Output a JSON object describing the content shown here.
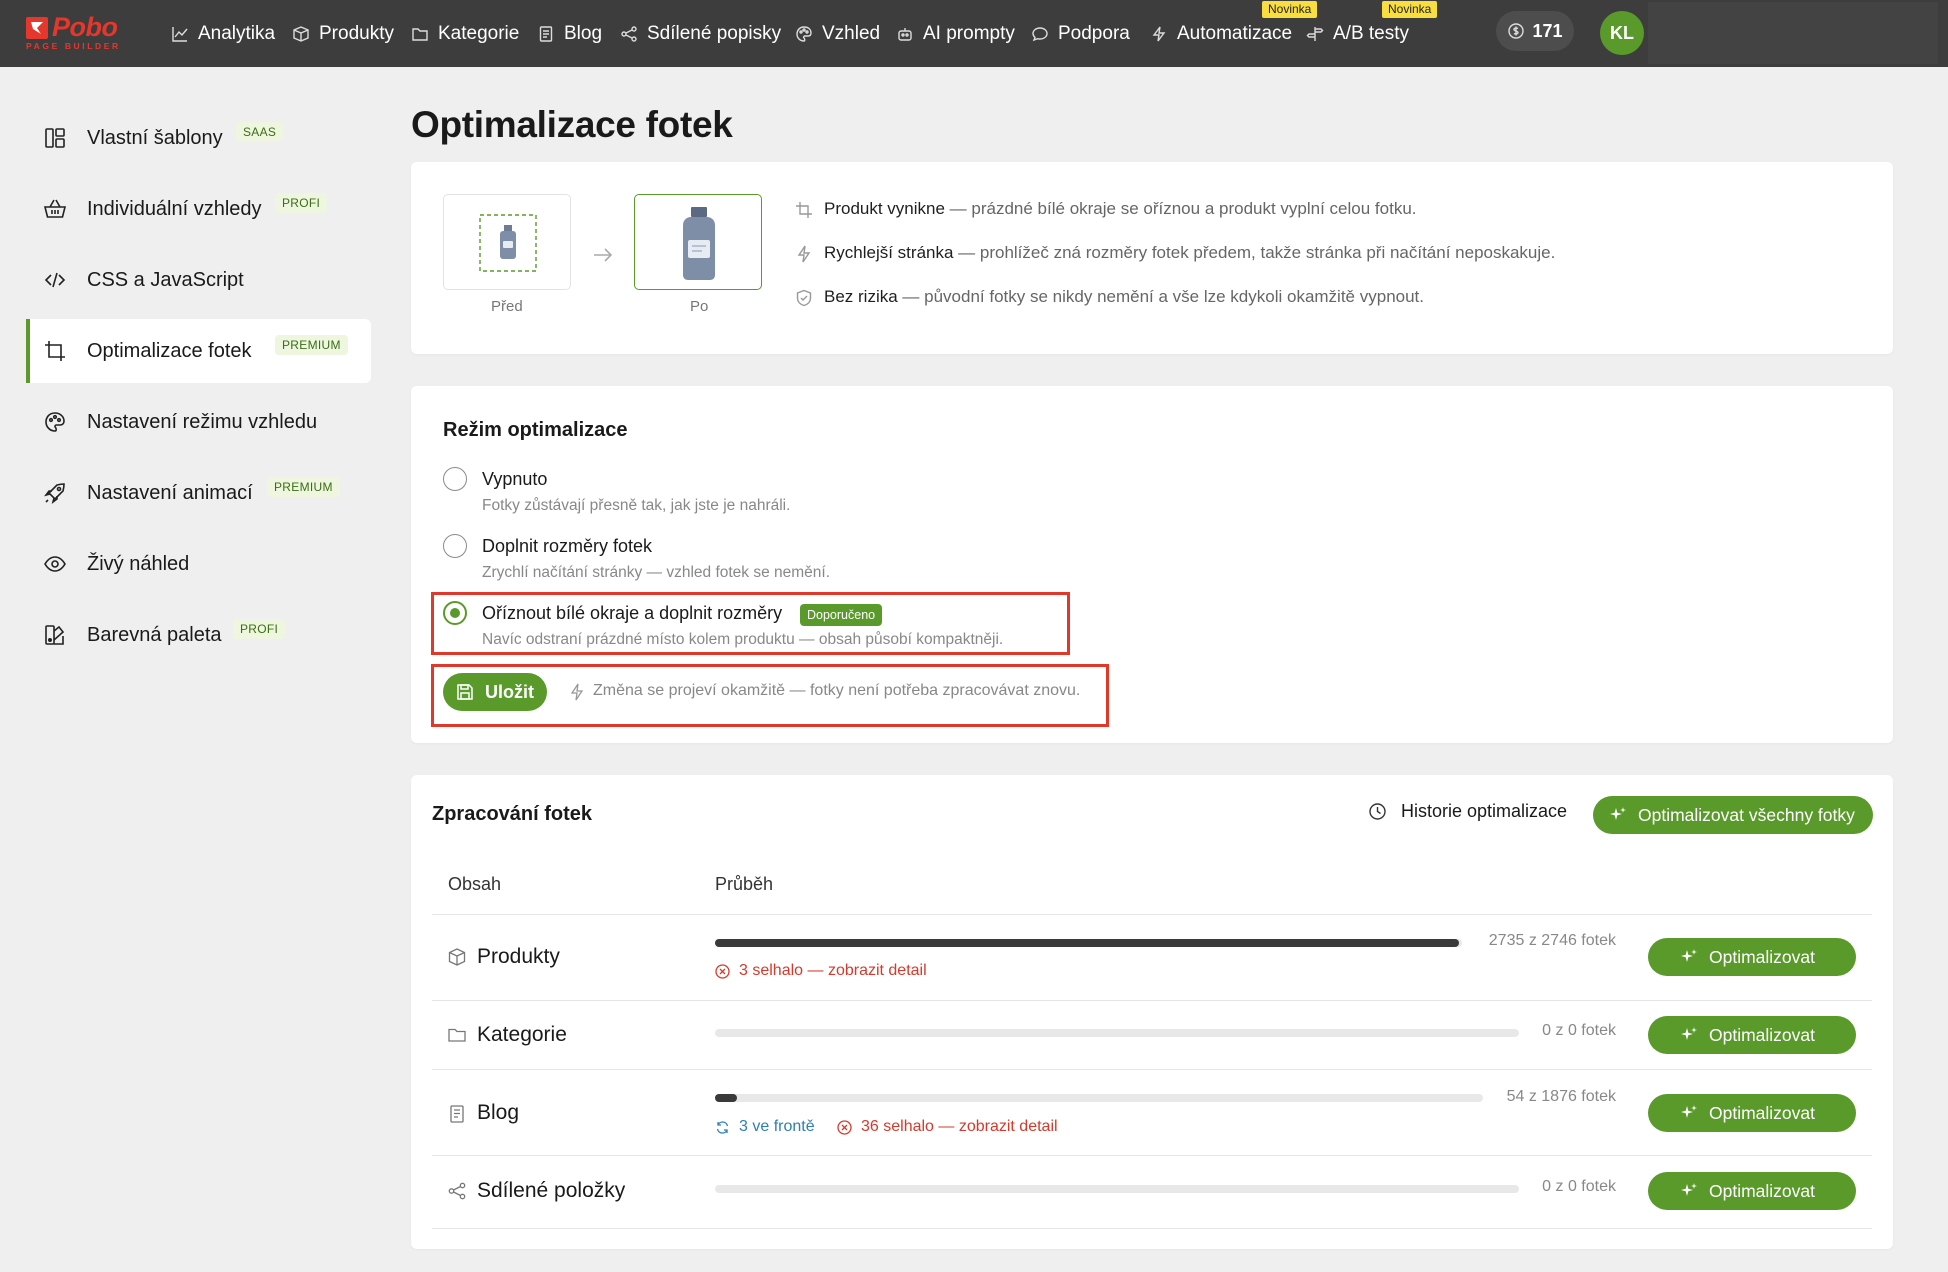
{
  "topbar": {
    "logo_text": "Pobo",
    "logo_sub": "PAGE BUILDER",
    "nav": [
      {
        "label": "Analytika",
        "icon": "chart-line-icon"
      },
      {
        "label": "Produkty",
        "icon": "box-icon"
      },
      {
        "label": "Kategorie",
        "icon": "folder-icon"
      },
      {
        "label": "Blog",
        "icon": "document-icon"
      },
      {
        "label": "Sdílené popisky",
        "icon": "share-icon"
      },
      {
        "label": "Vzhled",
        "icon": "palette-icon"
      },
      {
        "label": "AI prompty",
        "icon": "robot-icon"
      },
      {
        "label": "Podpora",
        "icon": "chat-icon"
      },
      {
        "label": "Automatizace",
        "icon": "lightning-icon",
        "badge": "Novinka"
      },
      {
        "label": "A/B testy",
        "icon": "signpost-icon",
        "badge": "Novinka"
      }
    ],
    "credits": "171",
    "avatar_initials": "KL"
  },
  "sidebar": {
    "items": [
      {
        "label": "Vlastní šablony",
        "badge": "SAAS",
        "icon": "layout-icon"
      },
      {
        "label": "Individuální vzhledy",
        "badge": "PROFI",
        "icon": "basket-icon"
      },
      {
        "label": "CSS a JavaScript",
        "badge": "",
        "icon": "code-icon"
      },
      {
        "label": "Optimalizace fotek",
        "badge": "PREMIUM",
        "icon": "crop-icon",
        "active": true
      },
      {
        "label": "Nastavení režimu vzhledu",
        "badge": "",
        "icon": "palette-icon"
      },
      {
        "label": "Nastavení animací",
        "badge": "PREMIUM",
        "icon": "rocket-icon"
      },
      {
        "label": "Živý náhled",
        "badge": "",
        "icon": "eye-icon"
      },
      {
        "label": "Barevná paleta",
        "badge": "PROFI",
        "icon": "swatch-icon"
      }
    ]
  },
  "page": {
    "title": "Optimalizace fotek"
  },
  "intro": {
    "before_label": "Před",
    "after_label": "Po",
    "benefits": [
      {
        "title": "Produkt vynikne",
        "text": " — prázdné bílé okraje se oříznou a produkt vyplní celou fotku.",
        "icon": "crop-icon"
      },
      {
        "title": "Rychlejší stránka",
        "text": " — prohlížeč zná rozměry fotek předem, takže stránka při načítání neposkakuje.",
        "icon": "lightning-icon"
      },
      {
        "title": "Bez rizika",
        "text": " — původní fotky se nikdy nemění a vše lze kdykoli okamžitě vypnout.",
        "icon": "shield-check-icon"
      }
    ]
  },
  "mode": {
    "title": "Režim optimalizace",
    "options": [
      {
        "label": "Vypnuto",
        "desc": "Fotky zůstávají přesně tak, jak jste je nahráli.",
        "checked": false
      },
      {
        "label": "Doplnit rozměry fotek",
        "desc": "Zrychlí načítání stránky — vzhled fotek se nemění.",
        "checked": false
      },
      {
        "label": "Oříznout bílé okraje a doplnit rozměry",
        "desc": "Navíc odstraní prázdné místo kolem produktu — obsah působí kompaktněji.",
        "checked": true,
        "badge": "Doporučeno"
      }
    ],
    "save_label": "Uložit",
    "save_hint": "Změna se projeví okamžitě — fotky není potřeba zpracovávat znovu."
  },
  "processing": {
    "title": "Zpracování fotek",
    "history_label": "Historie optimalizace",
    "optimize_all_label": "Optimalizovat všechny fotky",
    "col_content": "Obsah",
    "col_progress": "Průběh",
    "rows": [
      {
        "name": "Produkty",
        "icon": "box-icon",
        "done": 2735,
        "total": 2746,
        "count_text": "2735 z 2746 fotek",
        "fail_text": "3 selhalo — zobrazit detail",
        "queue_text": "",
        "button": "Optimalizovat"
      },
      {
        "name": "Kategorie",
        "icon": "folder-icon",
        "done": 0,
        "total": 0,
        "count_text": "0 z 0 fotek",
        "fail_text": "",
        "queue_text": "",
        "button": "Optimalizovat"
      },
      {
        "name": "Blog",
        "icon": "document-icon",
        "done": 54,
        "total": 1876,
        "count_text": "54 z 1876 fotek",
        "fail_text": "36 selhalo — zobrazit detail",
        "queue_text": "3 ve frontě",
        "button": "Optimalizovat"
      },
      {
        "name": "Sdílené položky",
        "icon": "share-icon",
        "done": 0,
        "total": 0,
        "count_text": "0 z 0 fotek",
        "fail_text": "",
        "queue_text": "",
        "button": "Optimalizovat"
      }
    ]
  },
  "colors": {
    "accent": "#5a9a2a",
    "topbar": "#3d3d3d",
    "brand": "#e5372b",
    "highlight": "#e0392b",
    "fail": "#d43a2c",
    "queue": "#2e7fb5"
  }
}
